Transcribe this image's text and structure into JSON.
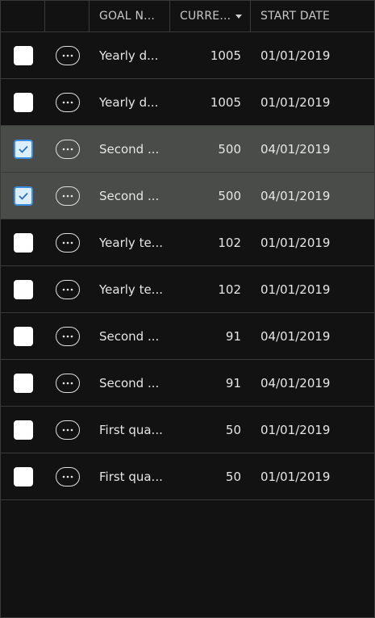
{
  "columns": {
    "goal_name": "GOAL N...",
    "current": "CURRE...",
    "start_date": "START DATE"
  },
  "rows": [
    {
      "name": "Yearly d...",
      "current": "1005",
      "start_date": "01/01/2019",
      "selected": false
    },
    {
      "name": "Yearly d...",
      "current": "1005",
      "start_date": "01/01/2019",
      "selected": false
    },
    {
      "name": "Second ...",
      "current": "500",
      "start_date": "04/01/2019",
      "selected": true
    },
    {
      "name": "Second ...",
      "current": "500",
      "start_date": "04/01/2019",
      "selected": true
    },
    {
      "name": "Yearly te...",
      "current": "102",
      "start_date": "01/01/2019",
      "selected": false
    },
    {
      "name": "Yearly te...",
      "current": "102",
      "start_date": "01/01/2019",
      "selected": false
    },
    {
      "name": "Second ...",
      "current": "91",
      "start_date": "04/01/2019",
      "selected": false
    },
    {
      "name": "Second ...",
      "current": "91",
      "start_date": "04/01/2019",
      "selected": false
    },
    {
      "name": "First qua...",
      "current": "50",
      "start_date": "01/01/2019",
      "selected": false
    },
    {
      "name": "First qua...",
      "current": "50",
      "start_date": "01/01/2019",
      "selected": false
    }
  ],
  "icons": {
    "sort": "sort-descending-icon",
    "more": "more-horizontal-icon",
    "check": "checkmark-icon"
  },
  "colors": {
    "background": "#121212",
    "selected_row": "#4a4c4a",
    "checkbox_checked_fill": "#dbeeff",
    "checkbox_checked_border": "#3b8de0"
  }
}
